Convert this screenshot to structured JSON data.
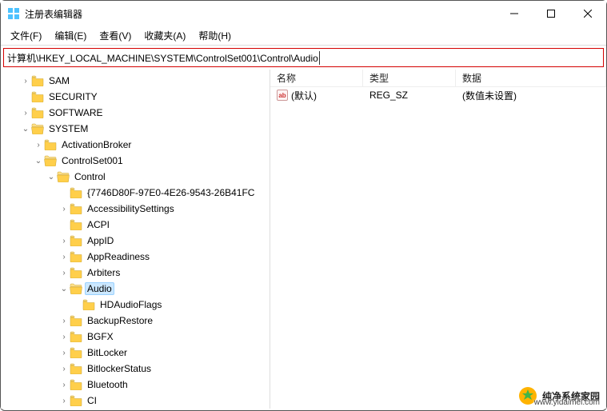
{
  "window": {
    "title": "注册表编辑器"
  },
  "menus": {
    "file": "文件(F)",
    "edit": "编辑(E)",
    "view": "查看(V)",
    "fav": "收藏夹(A)",
    "help": "帮助(H)"
  },
  "address": {
    "path": "计算机\\HKEY_LOCAL_MACHINE\\SYSTEM\\ControlSet001\\Control\\Audio"
  },
  "tree": {
    "sam": "SAM",
    "security": "SECURITY",
    "software": "SOFTWARE",
    "system": "SYSTEM",
    "activationbroker": "ActivationBroker",
    "controlset001": "ControlSet001",
    "control": "Control",
    "guid": "{7746D80F-97E0-4E26-9543-26B41FC",
    "accessibility": "AccessibilitySettings",
    "acpi": "ACPI",
    "appid": "AppID",
    "appreadiness": "AppReadiness",
    "arbiters": "Arbiters",
    "audio": "Audio",
    "hdaudioflags": "HDAudioFlags",
    "backuprestore": "BackupRestore",
    "bgfx": "BGFX",
    "bitlocker": "BitLocker",
    "bitlockerstatus": "BitlockerStatus",
    "bluetooth": "Bluetooth",
    "ci": "CI"
  },
  "list": {
    "headers": {
      "name": "名称",
      "type": "类型",
      "data": "数据"
    },
    "rows": {
      "0": {
        "icon": "ab",
        "name": "(默认)",
        "type": "REG_SZ",
        "data": "(数值未设置)"
      }
    }
  },
  "watermark": {
    "text": "纯净系统家园",
    "url": "www.yidaimei.com"
  }
}
